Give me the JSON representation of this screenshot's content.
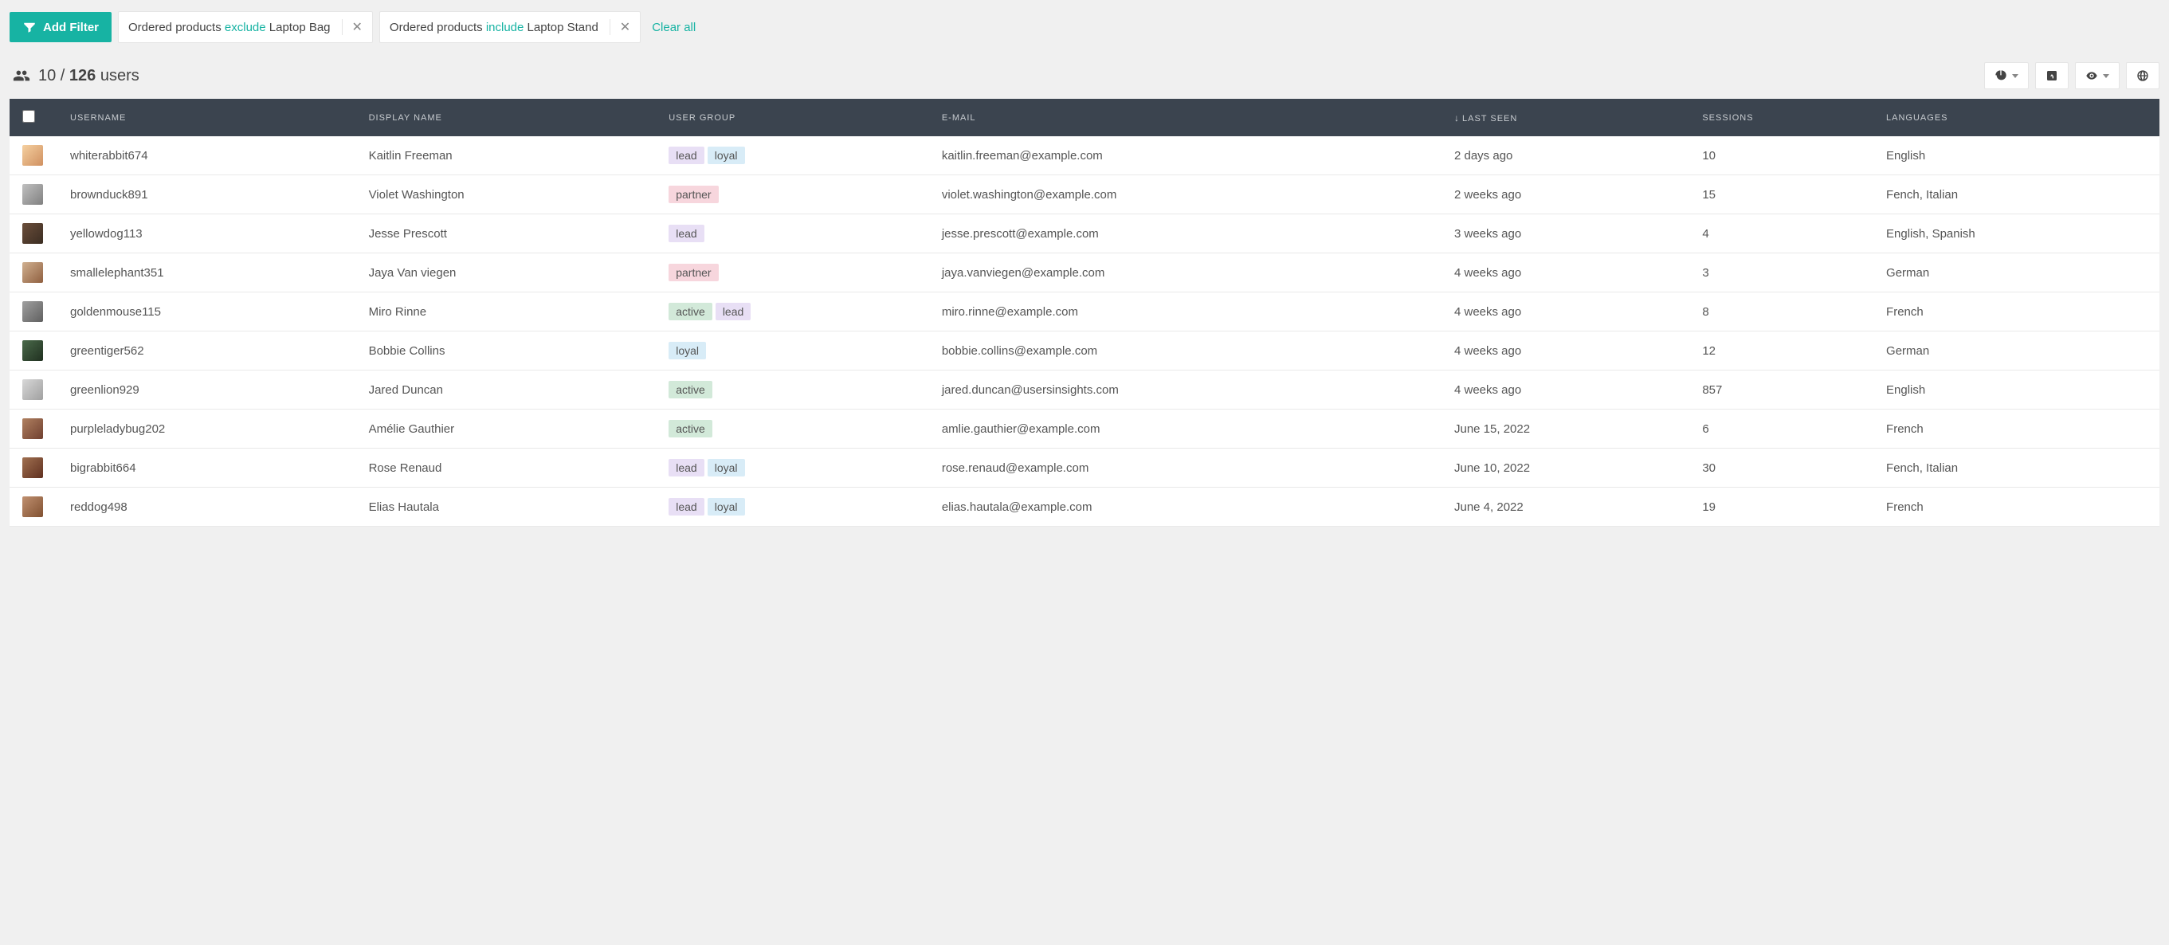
{
  "filters": {
    "add_label": "Add Filter",
    "clear_all": "Clear all",
    "chips": [
      {
        "prefix": "Ordered products ",
        "keyword": "exclude",
        "suffix": " Laptop Bag"
      },
      {
        "prefix": "Ordered products ",
        "keyword": "include",
        "suffix": " Laptop Stand"
      }
    ]
  },
  "summary": {
    "shown": "10",
    "sep": " / ",
    "total": "126",
    "label": " users"
  },
  "columns": {
    "username": "Username",
    "display_name": "Display Name",
    "user_group": "User Group",
    "email": "E-mail",
    "last_seen": "Last Seen",
    "sessions": "Sessions",
    "languages": "Languages"
  },
  "sort": {
    "column": "last_seen",
    "dir": "desc",
    "arrow": "↓"
  },
  "group_tags": {
    "lead": "lead",
    "loyal": "loyal",
    "partner": "partner",
    "active": "active"
  },
  "rows": [
    {
      "username": "whiterabbit674",
      "display_name": "Kaitlin Freeman",
      "groups": [
        "lead",
        "loyal"
      ],
      "email": "kaitlin.freeman@example.com",
      "last_seen": "2 days ago",
      "sessions": "10",
      "languages": "English"
    },
    {
      "username": "brownduck891",
      "display_name": "Violet Washington",
      "groups": [
        "partner"
      ],
      "email": "violet.washington@example.com",
      "last_seen": "2 weeks ago",
      "sessions": "15",
      "languages": "Fench, Italian"
    },
    {
      "username": "yellowdog113",
      "display_name": "Jesse Prescott",
      "groups": [
        "lead"
      ],
      "email": "jesse.prescott@example.com",
      "last_seen": "3 weeks ago",
      "sessions": "4",
      "languages": "English, Spanish"
    },
    {
      "username": "smallelephant351",
      "display_name": "Jaya Van viegen",
      "groups": [
        "partner"
      ],
      "email": "jaya.vanviegen@example.com",
      "last_seen": "4 weeks ago",
      "sessions": "3",
      "languages": "German"
    },
    {
      "username": "goldenmouse115",
      "display_name": "Miro Rinne",
      "groups": [
        "active",
        "lead"
      ],
      "email": "miro.rinne@example.com",
      "last_seen": "4 weeks ago",
      "sessions": "8",
      "languages": "French"
    },
    {
      "username": "greentiger562",
      "display_name": "Bobbie Collins",
      "groups": [
        "loyal"
      ],
      "email": "bobbie.collins@example.com",
      "last_seen": "4 weeks ago",
      "sessions": "12",
      "languages": "German"
    },
    {
      "username": "greenlion929",
      "display_name": "Jared Duncan",
      "groups": [
        "active"
      ],
      "email": "jared.duncan@usersinsights.com",
      "last_seen": "4 weeks ago",
      "sessions": "857",
      "languages": "English"
    },
    {
      "username": "purpleladybug202",
      "display_name": "Amélie Gauthier",
      "groups": [
        "active"
      ],
      "email": "amlie.gauthier@example.com",
      "last_seen": "June 15, 2022",
      "sessions": "6",
      "languages": "French"
    },
    {
      "username": "bigrabbit664",
      "display_name": "Rose Renaud",
      "groups": [
        "lead",
        "loyal"
      ],
      "email": "rose.renaud@example.com",
      "last_seen": "June 10, 2022",
      "sessions": "30",
      "languages": "Fench, Italian"
    },
    {
      "username": "reddog498",
      "display_name": "Elias Hautala",
      "groups": [
        "lead",
        "loyal"
      ],
      "email": "elias.hautala@example.com",
      "last_seen": "June 4, 2022",
      "sessions": "19",
      "languages": "French"
    }
  ]
}
